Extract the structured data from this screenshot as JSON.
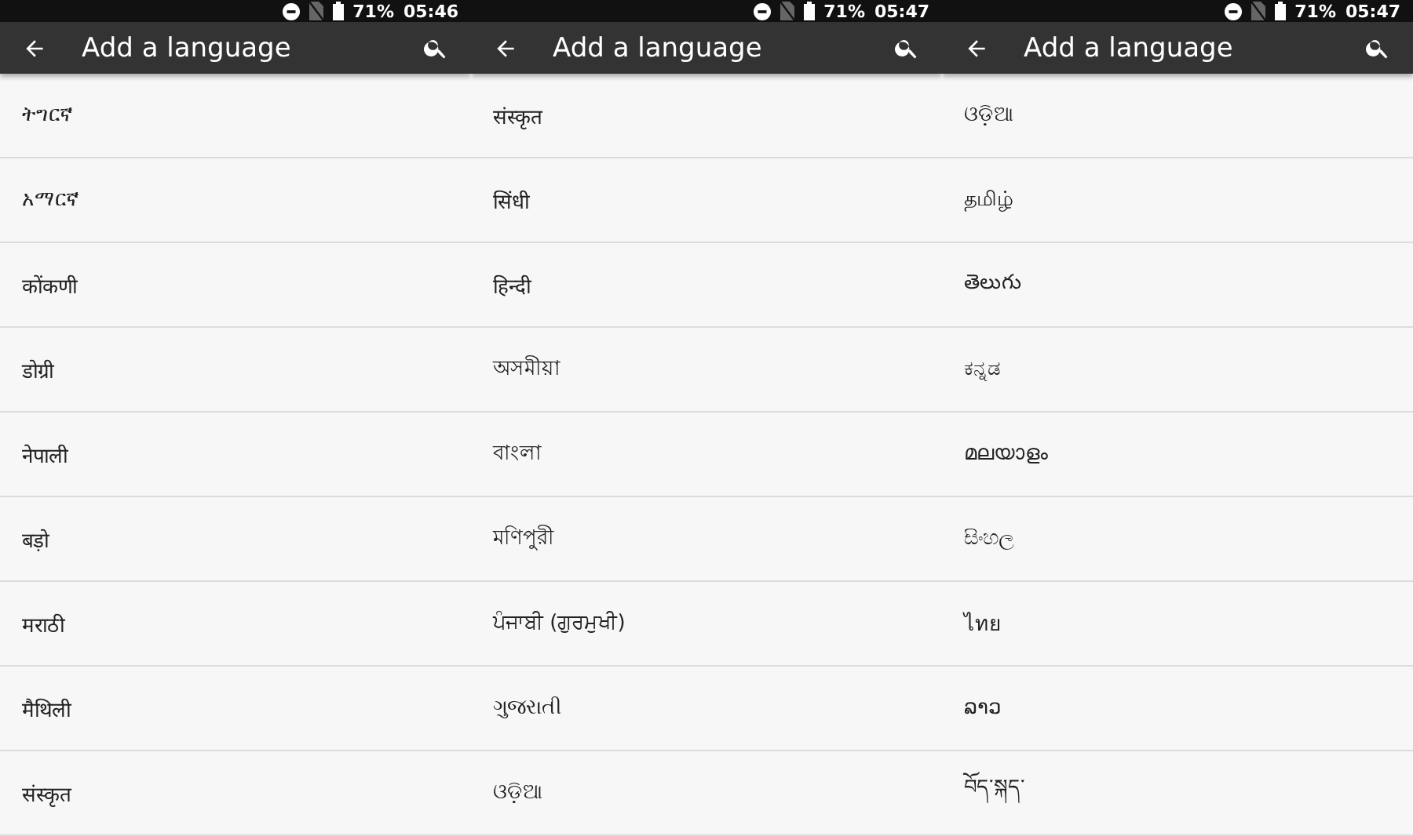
{
  "screens": [
    {
      "status_bar": {
        "battery": "71%",
        "time": "05:46"
      },
      "app_bar": {
        "title": "Add a language"
      },
      "languages": [
        "ትግርኛ",
        "አማርኛ",
        "कोंकणी",
        "डोग्री",
        "नेपाली",
        "बड़ो",
        "मराठी",
        "मैथिली",
        "संस्कृत"
      ]
    },
    {
      "status_bar": {
        "battery": "71%",
        "time": "05:47"
      },
      "app_bar": {
        "title": "Add a language"
      },
      "languages": [
        "संस्कृत",
        "सिंधी",
        "हिन्दी",
        "অসমীয়া",
        "বাংলা",
        "মণিপুরী",
        "ਪੰਜਾਬੀ (ਗੁਰਮੁਖੀ)",
        "ગુજરાતી",
        "ଓଡ଼ିଆ"
      ]
    },
    {
      "status_bar": {
        "battery": "71%",
        "time": "05:47"
      },
      "app_bar": {
        "title": "Add a language"
      },
      "languages": [
        "ଓଡ଼ିଆ",
        "தமிழ்",
        "తెలుగు",
        "ಕನ್ನಡ",
        "മലയാളം",
        "සිංහල",
        "ไทย",
        "ລາວ",
        "བོད་སྐད་"
      ]
    }
  ]
}
